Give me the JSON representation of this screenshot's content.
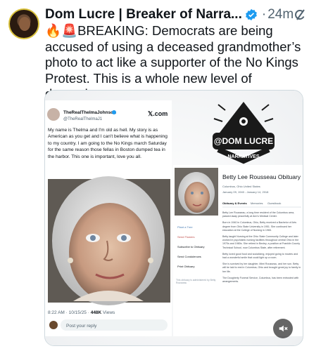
{
  "tweet": {
    "author_name": "Dom Lucre | Breaker of Narra...",
    "time": "24m",
    "separator": "·",
    "text": "🔥🚨BREAKING: Democrats are being accused of using a deceased grandmother’s photo to act like a supporter of the No Kings Protest. This is a whole new level of demonic."
  },
  "embedded_post": {
    "display_name": "TheRealThelmaJohnson",
    "handle": "@TheRealThelmaJ1",
    "platform": "𝕏.com",
    "body": "My name is Thelma and I'm old as hell.  My story is as American as you get and I can't believe what is happening to my country.  I am going to the No Kings march Saturday for the same reason those fellas in Boston dumped tea in the harbor.  This one is important, love you all.",
    "timestamp": "8:22 AM · 10/15/25 · ",
    "views_count": "448K",
    "views_label": " Views",
    "reply_placeholder": "Post your reply"
  },
  "watermark": {
    "line1": "@DOM LUCRE",
    "line2": "NARRATIVES"
  },
  "obituary": {
    "title": "Betty Lee Rousseau Obituary",
    "location": "Columbus, Ohio United States",
    "dates": "January 09, 1940 - January 14, 2018",
    "tabs": [
      "Obituary & Events",
      "Memories",
      "Guestbook"
    ],
    "actions": [
      "Plant a Tree",
      "Send Flowers",
      "Subscribe to Obituary",
      "Send Condolences",
      "Print Obituary"
    ],
    "paragraphs": [
      "Betty Lee Rousseau, a long time resident of the Columbus area, passed away peacefully at Ann's Medical Center.",
      "Born in 1940 in Columbus, Ohio, Betty received a Bachelor of Arts degree from Ohio State University in 1951. She continued her education at the College of Nursing in 1965.",
      "Betty taught Nursing at the Ohio State Community College and later worked in psychiatric nursing facilities throughout central Ohio in the 1970s and 1980s. She retired in Bexley, a position at Franklin County Technical School, now Columbus State, after retirement.",
      "Betty loved good food and socializing, enjoyed going to movies and had a wonderful smile that could light up a room.",
      "She is survived by her daughter, Mimi Rousseau, and her son. Betty will be laid to rest in Columbus, Ohio and brought great joy to family in her life.",
      "The Dougherty Funeral Service, Columbus, has been entrusted with arrangements."
    ],
    "note": "This obituary is administered by Betty Rousseau"
  },
  "icons": {
    "verified": "verified-badge-icon",
    "grok": "grok-icon",
    "mute": "volume-muted-icon"
  },
  "colors": {
    "accent": "#1d9bf0",
    "text": "#0f1419",
    "secondary": "#536471"
  }
}
